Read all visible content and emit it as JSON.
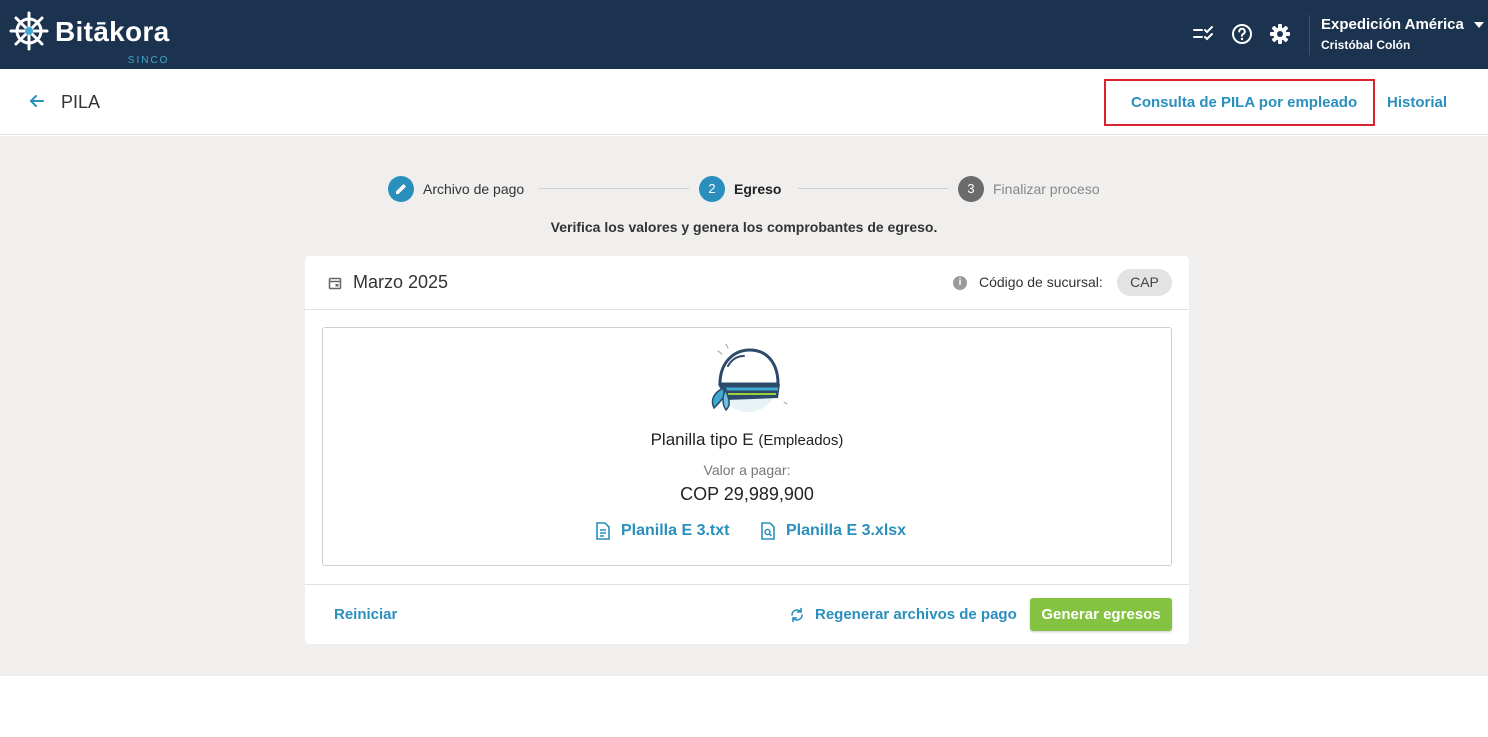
{
  "header": {
    "brand": "Bitākora",
    "brand_sub": "SINCO",
    "icons": [
      "checklist-icon",
      "help-icon",
      "settings-icon"
    ],
    "organization": "Expedición América",
    "user": "Cristóbal Colón"
  },
  "subheader": {
    "title": "PILA",
    "link_consulta": "Consulta de PILA por empleado",
    "link_historial": "Historial"
  },
  "stepper": {
    "steps": [
      {
        "number": "",
        "label": "Archivo de pago",
        "state": "done"
      },
      {
        "number": "2",
        "label": "Egreso",
        "state": "active"
      },
      {
        "number": "3",
        "label": "Finalizar proceso",
        "state": "pending"
      }
    ],
    "instruction": "Verifica los valores y genera los comprobantes de egreso."
  },
  "card": {
    "period": "Marzo 2025",
    "branch_label": "Código de sucursal:",
    "branch_code": "CAP",
    "planilla_type": "Planilla tipo E",
    "planilla_desc": "(Empleados)",
    "value_label": "Valor a pagar:",
    "value_amount": "COP 29,989,900",
    "files": [
      "Planilla E 3.txt",
      "Planilla E 3.xlsx"
    ],
    "reset_label": "Reiniciar",
    "regen_label": "Regenerar archivos de pago",
    "generate_label": "Generar egresos"
  },
  "colors": {
    "topbar": "#1c3350",
    "accent": "#2a8fbd",
    "primary_button": "#84c341",
    "highlight": "#d9232d"
  }
}
